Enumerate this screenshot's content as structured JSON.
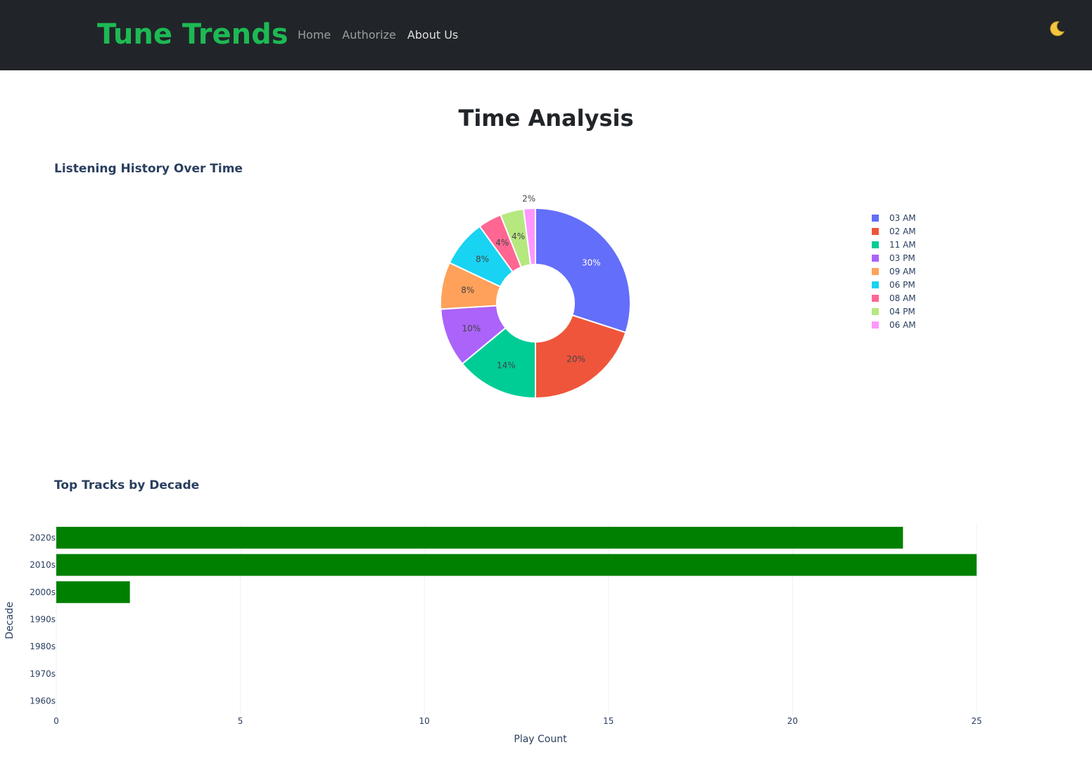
{
  "navbar": {
    "brand": "Tune Trends",
    "links": [
      {
        "label": "Home"
      },
      {
        "label": "Authorize"
      },
      {
        "label": "About Us"
      }
    ],
    "theme_icon": "moon-icon"
  },
  "page": {
    "title": "Time Analysis"
  },
  "colors": {
    "brand": "#1db954",
    "navbar_bg": "#212529",
    "bar": "#008000"
  },
  "chart_data": [
    {
      "type": "pie",
      "hole": true,
      "title": "Listening History Over Time",
      "legend_position": "right",
      "labels": [
        "03 AM",
        "02 AM",
        "11 AM",
        "03 PM",
        "09 AM",
        "06 PM",
        "08 AM",
        "04 PM",
        "06 AM"
      ],
      "values": [
        30,
        20,
        14,
        10,
        8,
        8,
        4,
        4,
        2
      ],
      "value_labels": [
        "30%",
        "20%",
        "14%",
        "10%",
        "8%",
        "8%",
        "4%",
        "4%",
        "2%"
      ],
      "colors": [
        "#636efa",
        "#EF553B",
        "#00cc96",
        "#ab63fa",
        "#FFA15A",
        "#19d3f3",
        "#FF6692",
        "#B6E880",
        "#FF97FF"
      ]
    },
    {
      "type": "bar",
      "orientation": "horizontal",
      "title": "Top Tracks by Decade",
      "xlabel": "Play Count",
      "ylabel": "Decade",
      "categories": [
        "1960s",
        "1970s",
        "1980s",
        "1990s",
        "2000s",
        "2010s",
        "2020s"
      ],
      "values": [
        0,
        0,
        0,
        0,
        2,
        25,
        23
      ],
      "xlim": [
        0,
        27.3
      ],
      "xticks": [
        "0",
        "5",
        "10",
        "15",
        "20",
        "25"
      ],
      "grid": true
    }
  ]
}
